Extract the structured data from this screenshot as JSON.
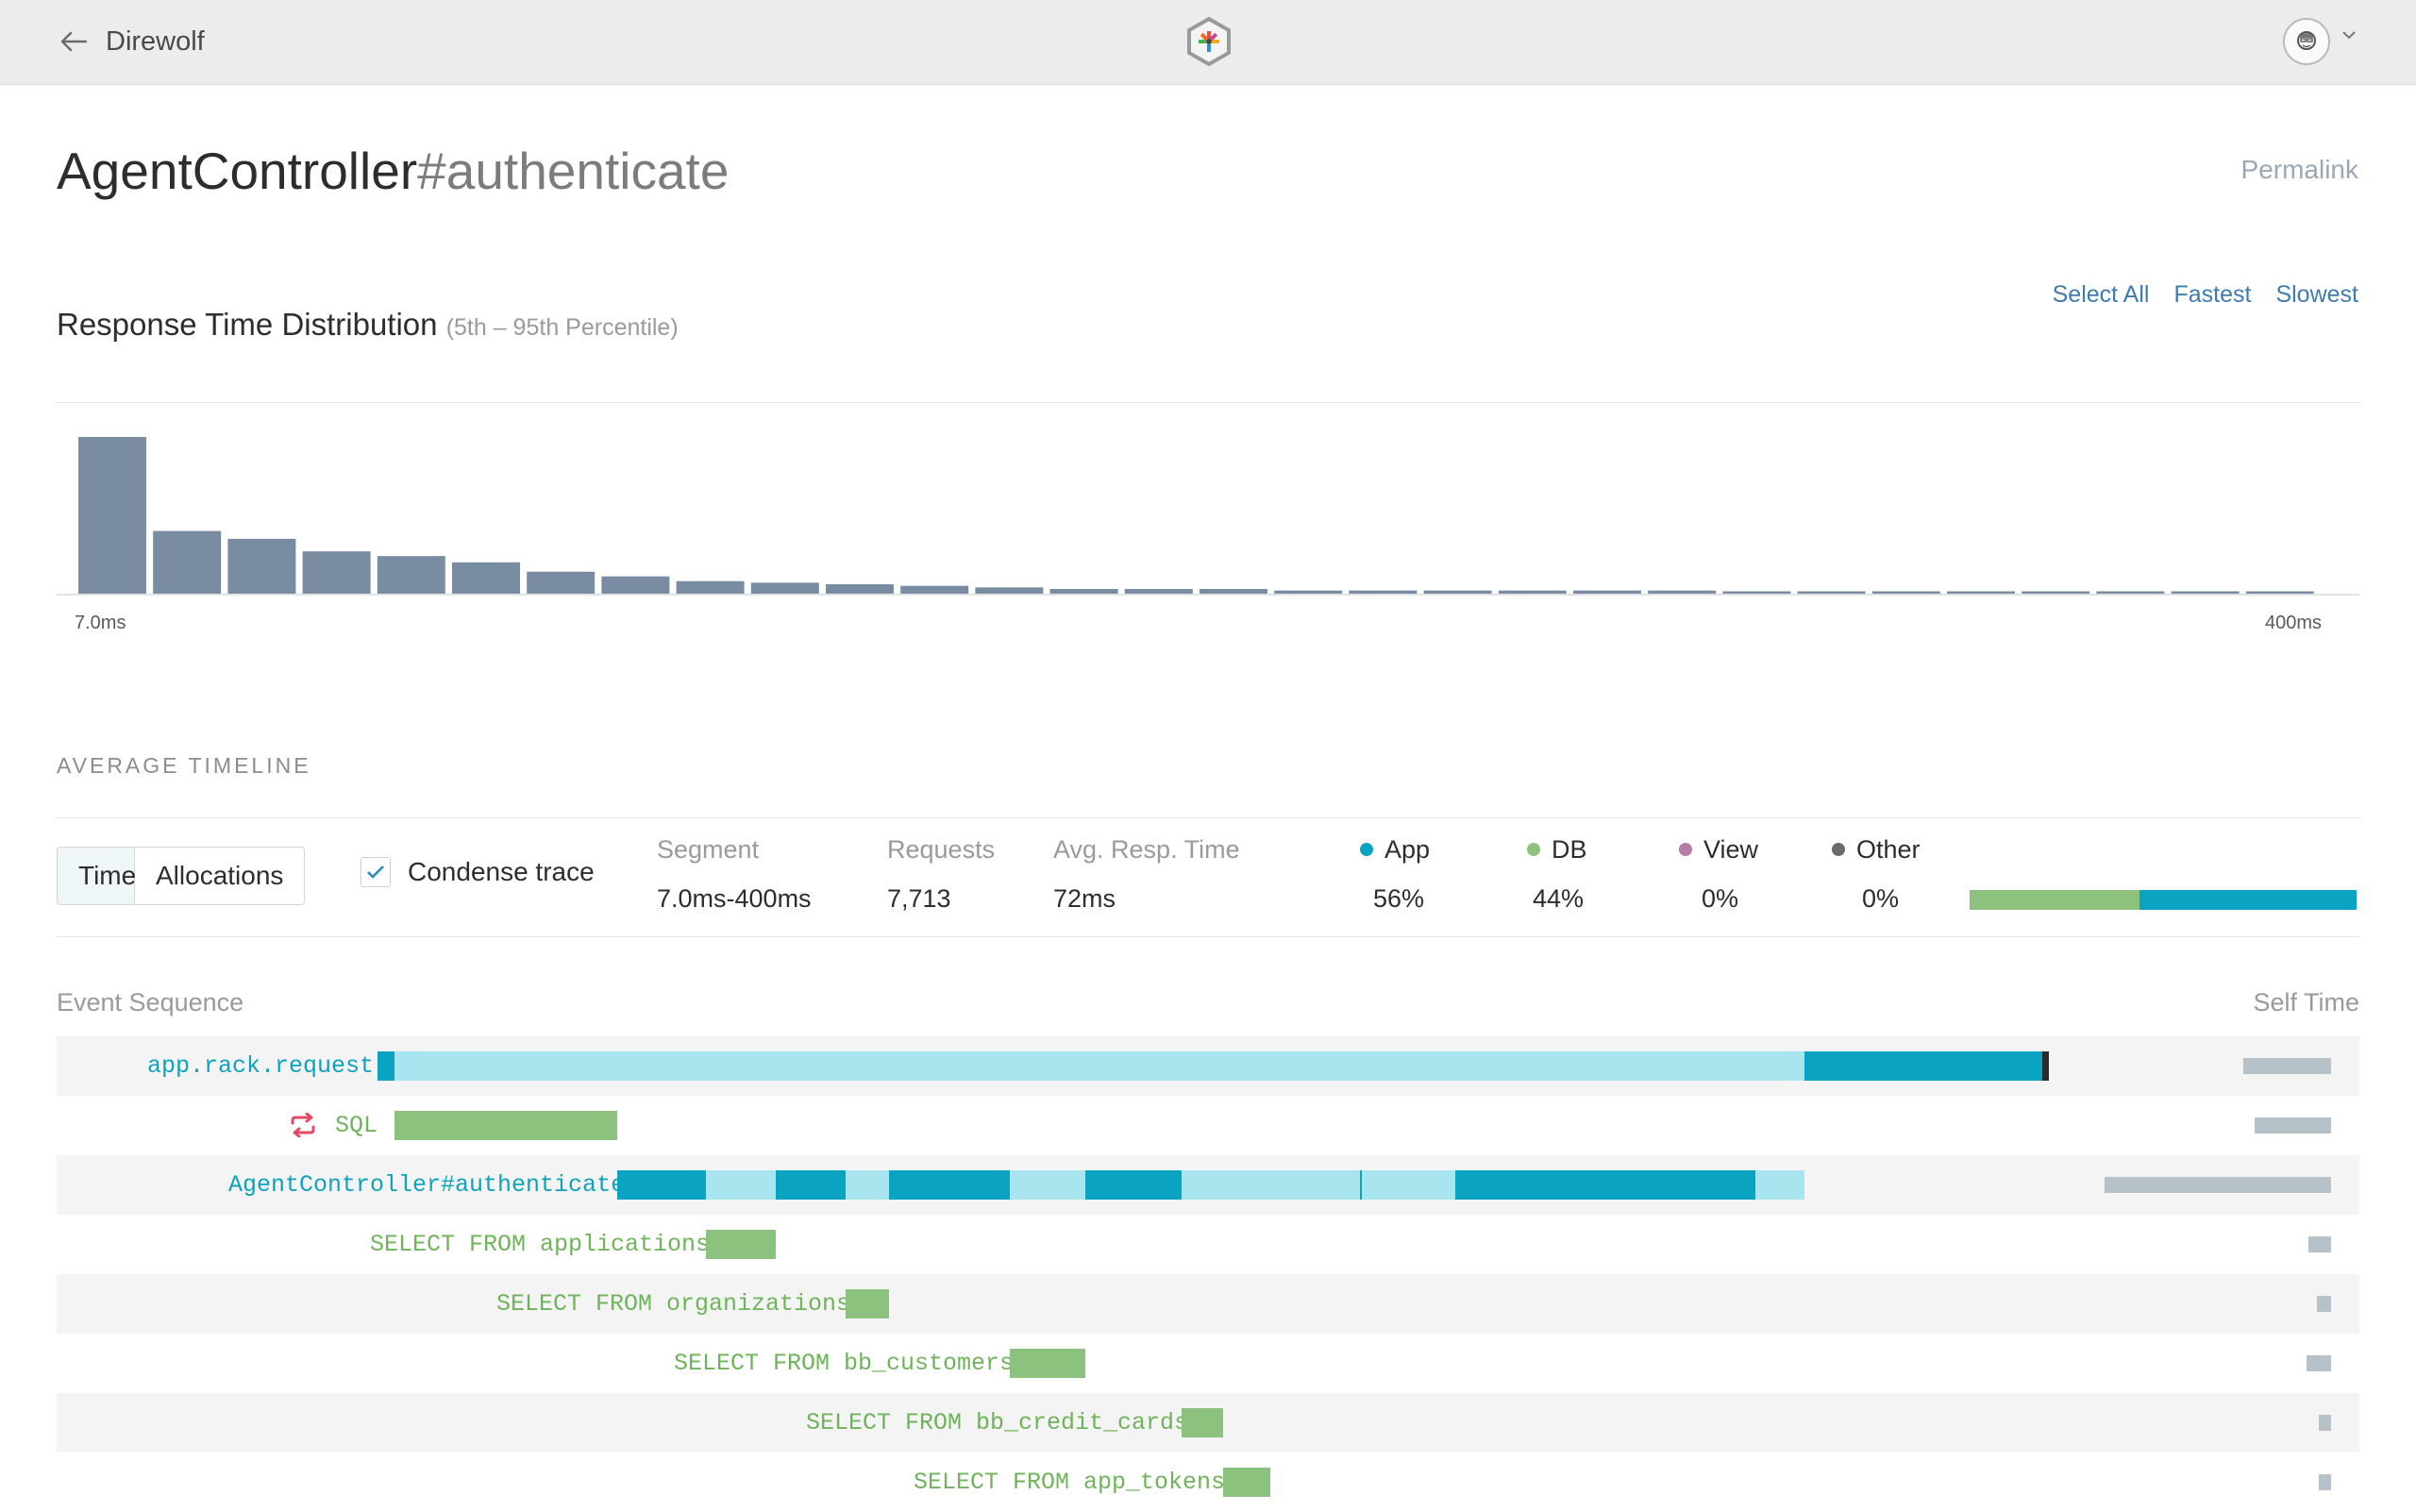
{
  "header": {
    "app_name": "Direwolf",
    "back_icon": "arrow-left-icon",
    "logo_icon": "hexagon-star-logo",
    "avatar_icon": "user-avatar-icon"
  },
  "page": {
    "title_controller": "AgentController",
    "title_action": "#authenticate",
    "permalink": "Permalink"
  },
  "distribution": {
    "title": "Response Time Distribution",
    "subtitle": "(5th – 95th Percentile)",
    "links": [
      "Select All",
      "Fastest",
      "Slowest"
    ]
  },
  "chart_data": {
    "type": "bar",
    "title": "Response Time Distribution",
    "subtitle": "(5th – 95th Percentile)",
    "x_start_label": "7.0ms",
    "x_end_label": "400ms",
    "values": [
      100,
      40,
      35,
      27,
      24,
      20,
      14,
      11,
      8,
      7,
      6,
      5,
      4,
      3,
      3,
      3,
      2,
      2,
      2,
      2,
      2,
      2,
      1.5,
      1.5,
      1.5,
      1.5,
      1.5,
      1.5,
      1.5,
      1.5
    ],
    "ylim": [
      0,
      110
    ],
    "grid": false,
    "color": "#7a8ca2"
  },
  "timeline": {
    "title": "AVERAGE TIMELINE",
    "toggle": [
      "Time",
      "Allocations"
    ],
    "condense_label": "Condense trace",
    "condense_checked": true,
    "stats": [
      {
        "label": "Segment",
        "value": "7.0ms-400ms"
      },
      {
        "label": "Requests",
        "value": "7,713"
      },
      {
        "label": "Avg. Resp. Time",
        "value": "72ms"
      }
    ],
    "breakdown": [
      {
        "label": "App",
        "value": "56%",
        "color": "#0aa3c2",
        "fraction": 0.56
      },
      {
        "label": "DB",
        "value": "44%",
        "color": "#8cc27e",
        "fraction": 0.44
      },
      {
        "label": "View",
        "value": "0%",
        "color": "#b57ca6",
        "fraction": 0
      },
      {
        "label": "Other",
        "value": "0%",
        "color": "#6a6a6a",
        "fraction": 0
      }
    ]
  },
  "events": {
    "header_left": "Event Sequence",
    "header_right": "Self Time",
    "sql_repeat_icon": "repeat-icon",
    "rows": [
      {
        "label": "app.rack.request",
        "kind": "app"
      },
      {
        "label": "SQL",
        "kind": "db",
        "repeat": true
      },
      {
        "label": "AgentController#authenticate",
        "kind": "app"
      },
      {
        "label": "SELECT FROM applications",
        "kind": "db"
      },
      {
        "label": "SELECT FROM organizations",
        "kind": "db"
      },
      {
        "label": "SELECT FROM bb_customers",
        "kind": "db"
      },
      {
        "label": "SELECT FROM bb_credit_cards",
        "kind": "db"
      },
      {
        "label": "SELECT FROM app_tokens",
        "kind": "db"
      }
    ]
  }
}
